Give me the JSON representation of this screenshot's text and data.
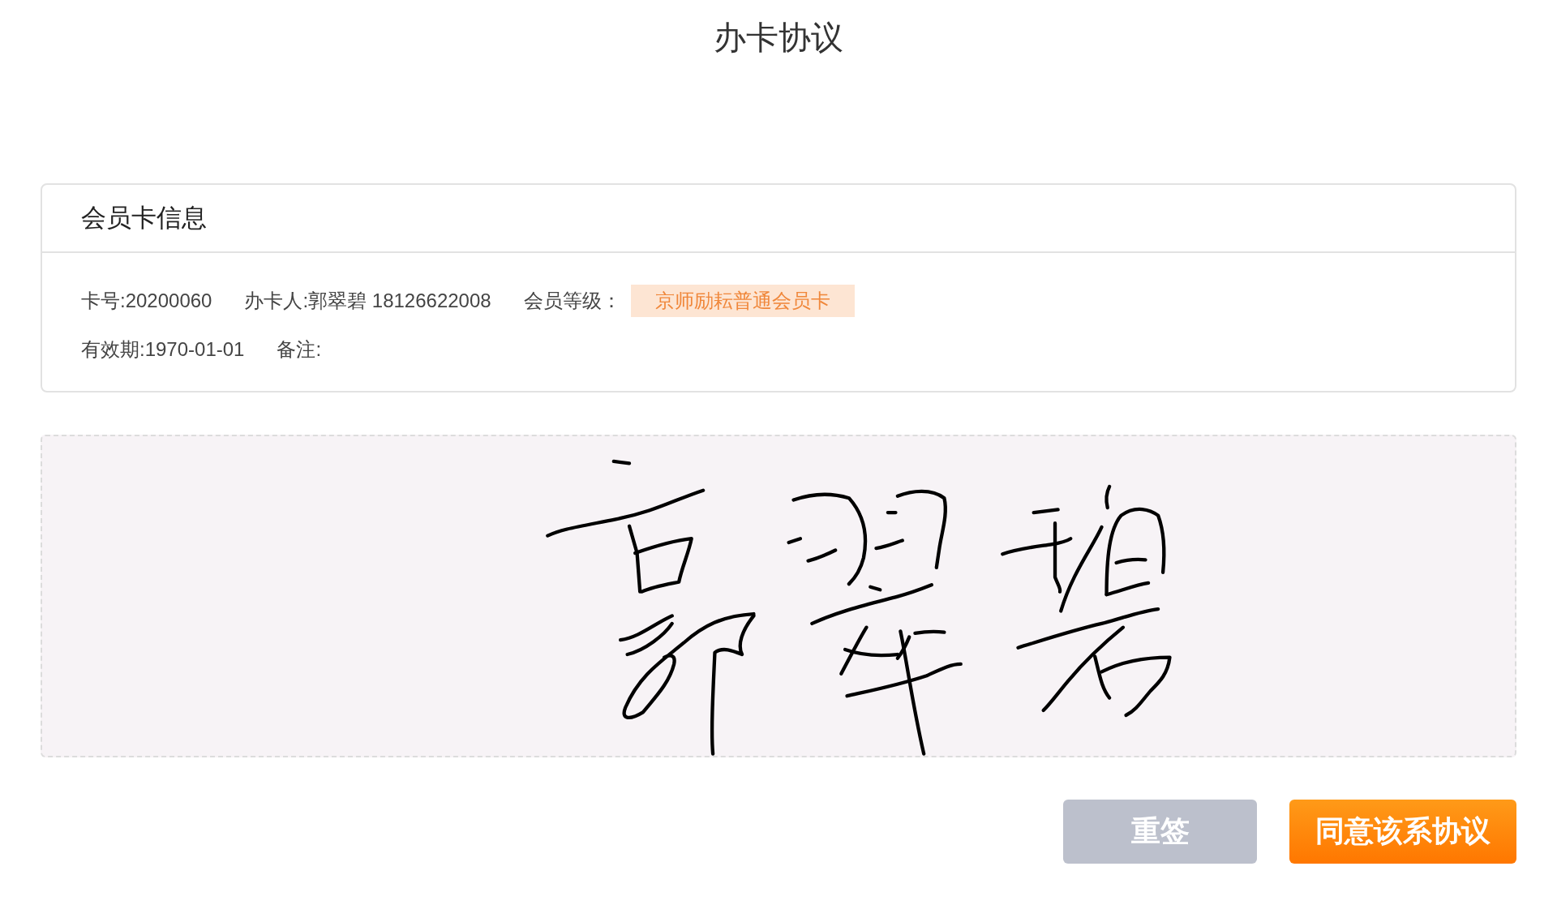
{
  "title": "办卡协议",
  "card": {
    "title": "会员卡信息",
    "rows": [
      [
        {
          "kind": "text",
          "text": "卡号:20200060"
        },
        {
          "kind": "text",
          "text": "办卡人:郭翠碧 18126622008"
        },
        {
          "kind": "badge",
          "label": "会员等级：",
          "value": "京师励耘普通会员卡"
        }
      ],
      [
        {
          "kind": "text",
          "text": "有效期:1970-01-01"
        },
        {
          "kind": "text",
          "text": "备注:"
        }
      ]
    ]
  },
  "signature_pad": {
    "signed": true
  },
  "buttons": [
    {
      "kind": "secondary",
      "label": "重签"
    },
    {
      "kind": "primary",
      "label": "同意该系协议"
    }
  ]
}
